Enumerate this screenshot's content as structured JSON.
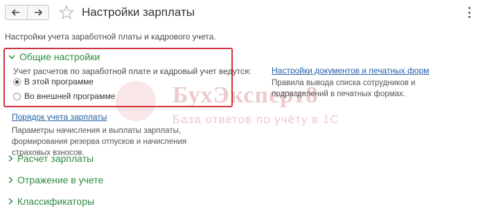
{
  "window": {
    "title": "Настройки зарплаты",
    "subtitle": "Настройки учета заработной платы и кадрового учета."
  },
  "toolbar": {
    "back_icon": "arrow-left-icon",
    "forward_icon": "arrow-right-icon",
    "favorite_icon": "star-icon",
    "more_icon": "more-vertical-icon"
  },
  "general_settings": {
    "label": "Общие настройки",
    "expanded": true,
    "mode_question": "Учет расчетов по заработной плате и кадровый учет ведутся:",
    "options": [
      {
        "label": "В этой программе",
        "selected": true
      },
      {
        "label": "Во внешней программе",
        "selected": false
      }
    ]
  },
  "salary_order": {
    "link": "Порядок учета зарплаты",
    "description": "Параметры начисления и выплаты зарплаты, формирования резерва отпусков и начисления страховых взносов."
  },
  "documents": {
    "link": "Настройки документов и печатных форм",
    "description": "Правила вывода списка сотрудников и подразделений в печатных формах."
  },
  "sections": [
    {
      "label": "Расчет зарплаты"
    },
    {
      "label": "Отражение в учете"
    },
    {
      "label": "Классификаторы"
    }
  ],
  "watermark": {
    "title": "БухЭксперт8",
    "subtitle": "База ответов по учёту в 1С"
  },
  "colors": {
    "accent_green": "#2e8b3e",
    "link_blue": "#1f5fa6",
    "highlight_red": "#d0303a"
  }
}
